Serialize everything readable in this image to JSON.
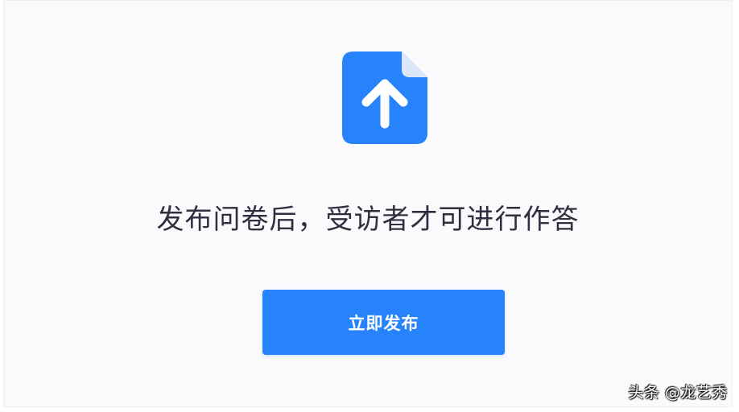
{
  "icon": {
    "name": "file-upload-icon",
    "color": "#2783fc",
    "fold_color": "#dbe6fb"
  },
  "message": "发布问卷后，受访者才可进行作答",
  "publish_button": {
    "label": "立即发布",
    "color": "#2783fc"
  },
  "watermark": "头条 @龙艺秀"
}
